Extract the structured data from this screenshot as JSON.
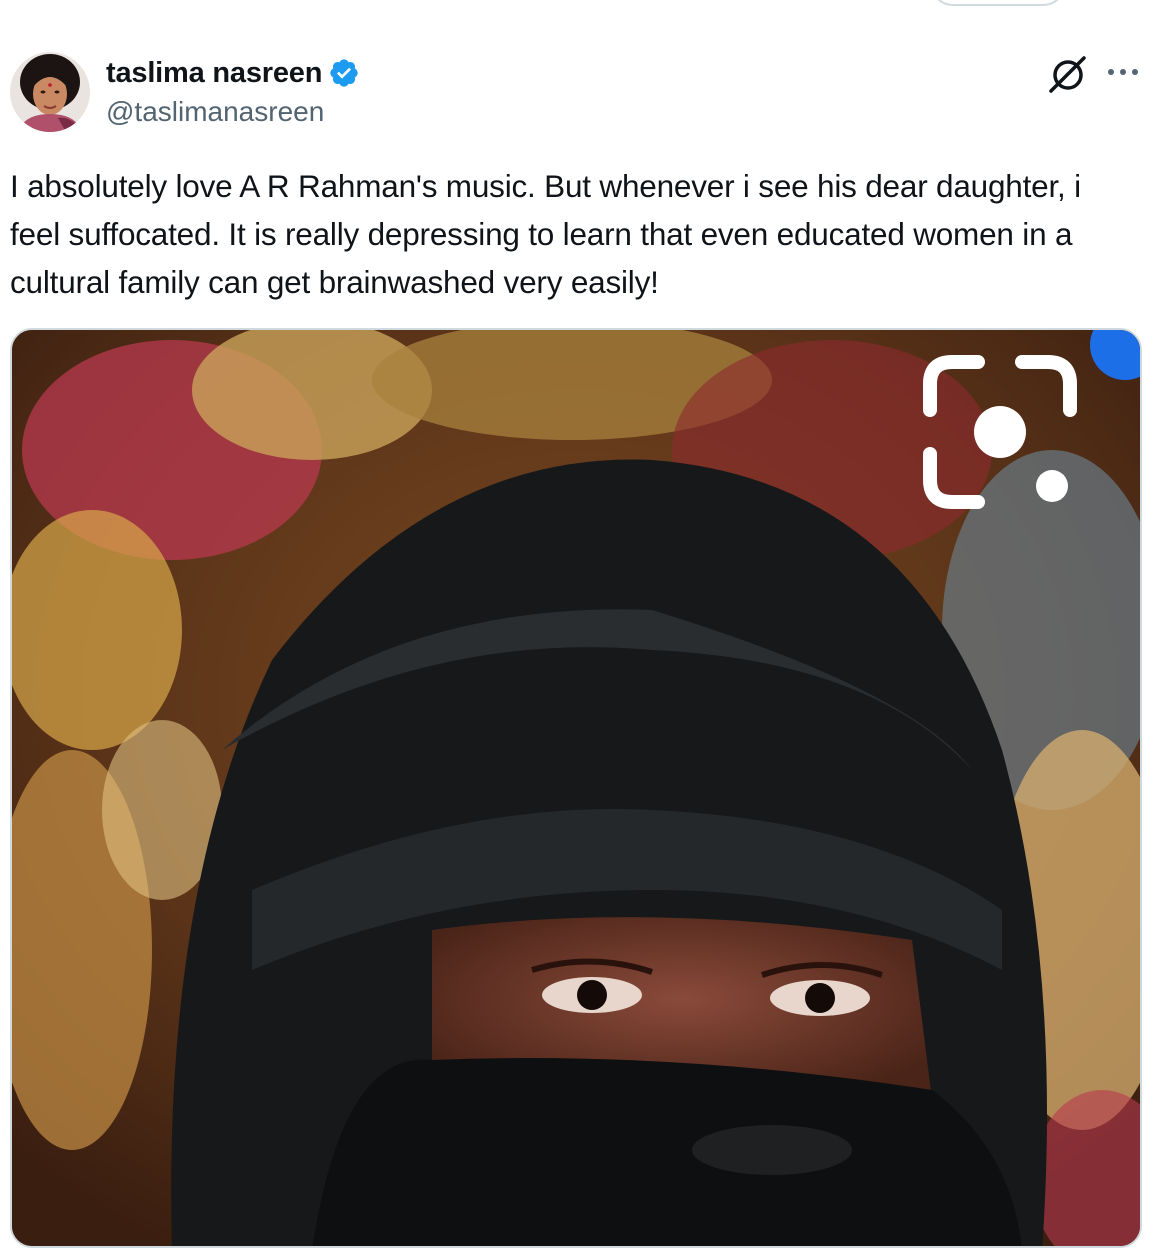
{
  "author": {
    "display_name": "taslima nasreen",
    "handle": "@taslimanasreen",
    "verified": true,
    "avatar_icon": "profile-photo",
    "verified_color": "#1d9bf0"
  },
  "header_actions": {
    "grok_icon": "grok-icon",
    "more_icon": "more-options-icon"
  },
  "tweet": {
    "text": "I absolutely love A R Rahman's music. But whenever i see his dear daughter, i feel suffocated. It is really depressing to learn that even educated women in a  cultural family can get brainwashed very easily!"
  },
  "media": {
    "overlay_icon": "google-lens-icon",
    "badge_color": "#1d6fe8"
  },
  "colors": {
    "text_primary": "#0f1419",
    "text_secondary": "#536471",
    "border": "#cfd9de"
  }
}
